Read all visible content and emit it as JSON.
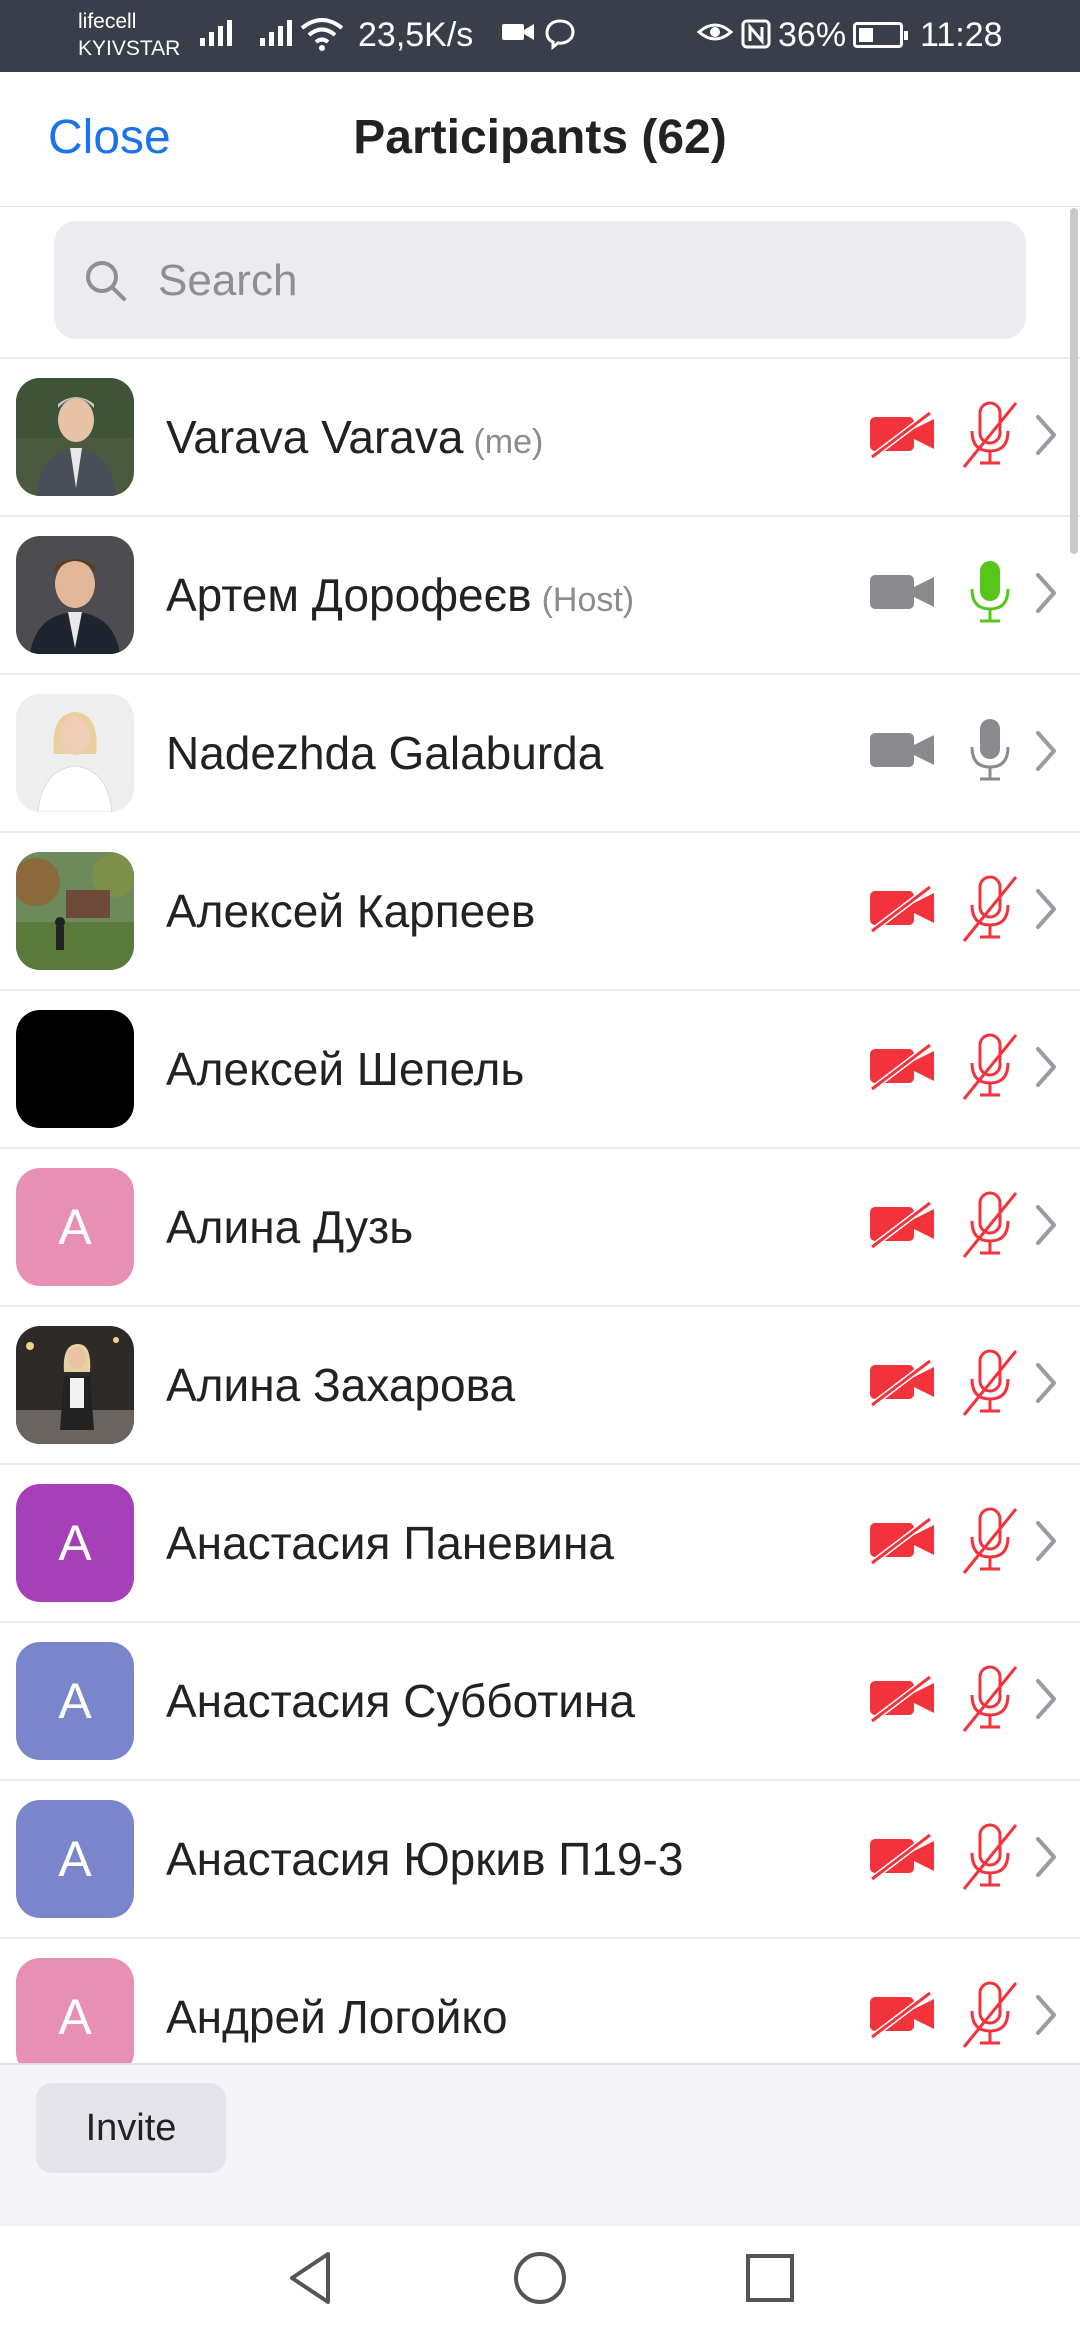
{
  "status_bar": {
    "carrier_1": "lifecell",
    "carrier_2": "KYIVSTAR",
    "speed": "23,5K/s",
    "battery": "36%",
    "time": "11:28"
  },
  "header": {
    "close_label": "Close",
    "title": "Participants (62)"
  },
  "search": {
    "placeholder": "Search",
    "value": ""
  },
  "participants": [
    {
      "name": "Varava Varava",
      "tag": "(me)",
      "avatar": "photo-man-gray-suit",
      "video": "off",
      "audio": "muted"
    },
    {
      "name": "Артем Дорофеєв",
      "tag": "(Host)",
      "avatar": "photo-man-dark-suit",
      "video": "on",
      "audio": "speaking"
    },
    {
      "name": "Nadezhda Galaburda",
      "tag": "",
      "avatar": "photo-woman-white",
      "video": "on",
      "audio": "unmuted"
    },
    {
      "name": "Алексей Карпеев",
      "tag": "",
      "avatar": "photo-park",
      "video": "off",
      "audio": "muted"
    },
    {
      "name": "Алексей Шепель",
      "tag": "",
      "avatar": "black",
      "video": "off",
      "audio": "muted"
    },
    {
      "name": "Алина Дузь",
      "tag": "",
      "avatar": "letter",
      "letter": "A",
      "color": "#e88fb4",
      "video": "off",
      "audio": "muted"
    },
    {
      "name": "Алина Захарова",
      "tag": "",
      "avatar": "photo-woman-street",
      "video": "off",
      "audio": "muted"
    },
    {
      "name": "Анастасия Паневина",
      "tag": "",
      "avatar": "letter",
      "letter": "A",
      "color": "#a740b8",
      "video": "off",
      "audio": "muted"
    },
    {
      "name": "Анастасия Субботина",
      "tag": "",
      "avatar": "letter",
      "letter": "A",
      "color": "#7a86cc",
      "video": "off",
      "audio": "muted"
    },
    {
      "name": "Анастасия Юркив П19-3",
      "tag": "",
      "avatar": "letter",
      "letter": "A",
      "color": "#7a86cc",
      "video": "off",
      "audio": "muted"
    },
    {
      "name": "Андрей Логойко",
      "tag": "",
      "avatar": "letter",
      "letter": "A",
      "color": "#e88fb4",
      "video": "off",
      "audio": "muted"
    }
  ],
  "footer": {
    "invite_label": "Invite"
  },
  "colors": {
    "accent": "#1a74e8",
    "muted_red": "#f2333c",
    "speaking_green": "#56c61a",
    "icon_gray": "#8a8a8e"
  }
}
